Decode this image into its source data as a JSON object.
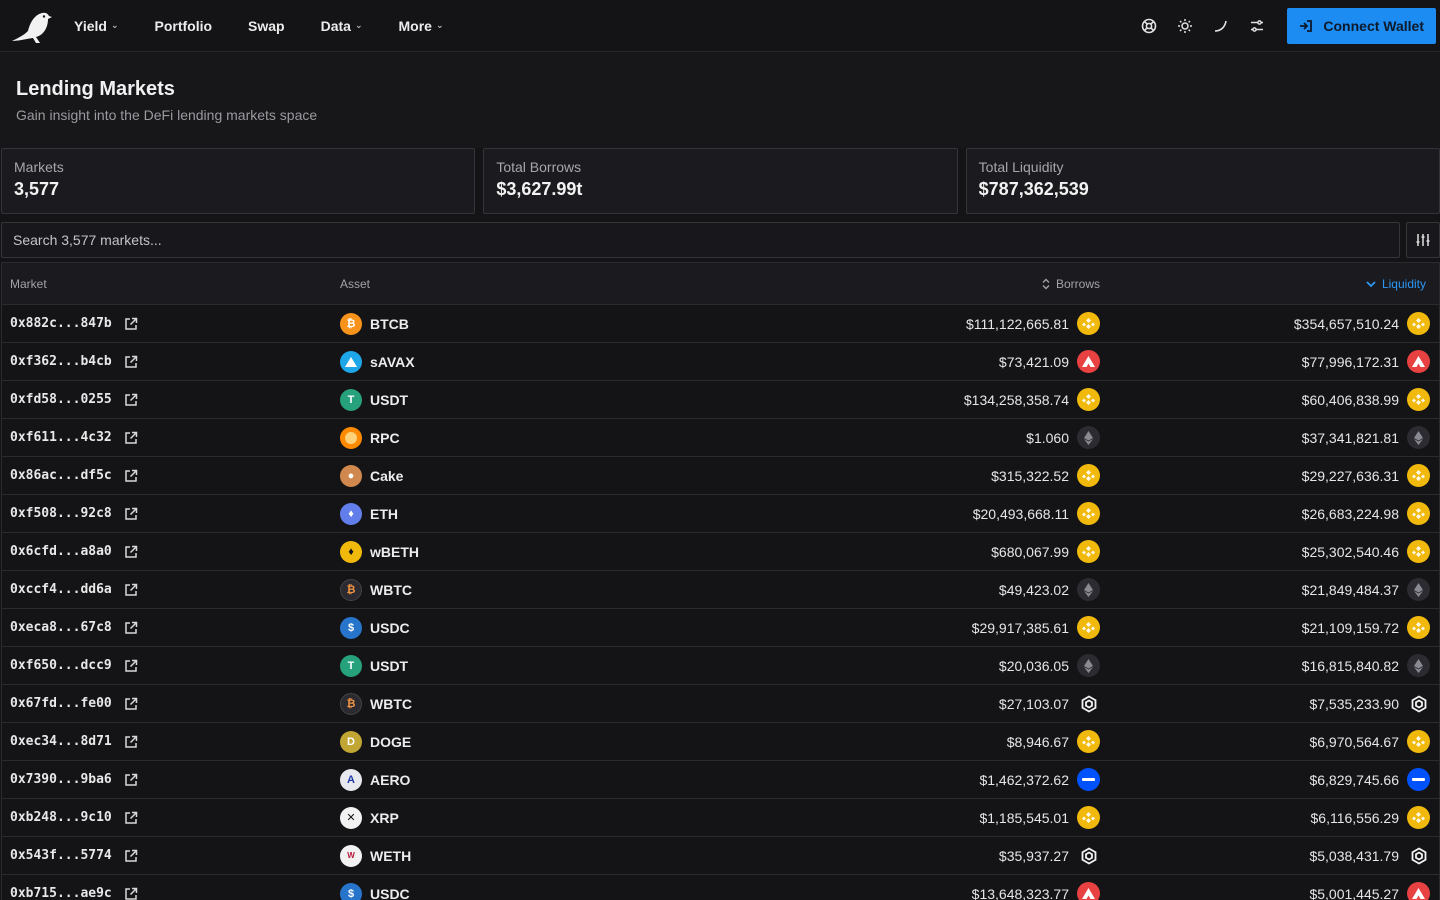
{
  "nav": {
    "items": [
      {
        "label": "Yield",
        "dropdown": true
      },
      {
        "label": "Portfolio",
        "dropdown": false
      },
      {
        "label": "Swap",
        "dropdown": false
      },
      {
        "label": "Data",
        "dropdown": true
      },
      {
        "label": "More",
        "dropdown": true
      }
    ],
    "connect_label": "Connect Wallet"
  },
  "page": {
    "title": "Lending Markets",
    "subtitle": "Gain insight into the DeFi lending markets space"
  },
  "stats": [
    {
      "label": "Markets",
      "value": "3,577"
    },
    {
      "label": "Total Borrows",
      "value": "$3,627.99t"
    },
    {
      "label": "Total Liquidity",
      "value": "$787,362,539"
    }
  ],
  "search": {
    "placeholder": "Search 3,577 markets..."
  },
  "table": {
    "headers": {
      "market": "Market",
      "asset": "Asset",
      "borrows": "Borrows",
      "liquidity": "Liquidity"
    },
    "sorted_by": "Liquidity",
    "rows": [
      {
        "market": "0x882c...847b",
        "asset": "BTCB",
        "asset_icon": "btcb",
        "borrows": "$111,122,665.81",
        "liquidity": "$354,657,510.24",
        "chain": "bnb"
      },
      {
        "market": "0xf362...b4cb",
        "asset": "sAVAX",
        "asset_icon": "savax",
        "borrows": "$73,421.09",
        "liquidity": "$77,996,172.31",
        "chain": "avalanche"
      },
      {
        "market": "0xfd58...0255",
        "asset": "USDT",
        "asset_icon": "usdt",
        "borrows": "$134,258,358.74",
        "liquidity": "$60,406,838.99",
        "chain": "bnb"
      },
      {
        "market": "0xf611...4c32",
        "asset": "RPC",
        "asset_icon": "rpc",
        "borrows": "$1.060",
        "liquidity": "$37,341,821.81",
        "chain": "ethereum"
      },
      {
        "market": "0x86ac...df5c",
        "asset": "Cake",
        "asset_icon": "cake",
        "borrows": "$315,322.52",
        "liquidity": "$29,227,636.31",
        "chain": "bnb"
      },
      {
        "market": "0xf508...92c8",
        "asset": "ETH",
        "asset_icon": "eth",
        "borrows": "$20,493,668.11",
        "liquidity": "$26,683,224.98",
        "chain": "bnb"
      },
      {
        "market": "0x6cfd...a8a0",
        "asset": "wBETH",
        "asset_icon": "wbeth",
        "borrows": "$680,067.99",
        "liquidity": "$25,302,540.46",
        "chain": "bnb"
      },
      {
        "market": "0xccf4...dd6a",
        "asset": "WBTC",
        "asset_icon": "wbtc",
        "borrows": "$49,423.02",
        "liquidity": "$21,849,484.37",
        "chain": "ethereum"
      },
      {
        "market": "0xeca8...67c8",
        "asset": "USDC",
        "asset_icon": "usdc",
        "borrows": "$29,917,385.61",
        "liquidity": "$21,109,159.72",
        "chain": "bnb"
      },
      {
        "market": "0xf650...dcc9",
        "asset": "USDT",
        "asset_icon": "usdt",
        "borrows": "$20,036.05",
        "liquidity": "$16,815,840.82",
        "chain": "ethereum"
      },
      {
        "market": "0x67fd...fe00",
        "asset": "WBTC",
        "asset_icon": "wbtc",
        "borrows": "$27,103.07",
        "liquidity": "$7,535,233.90",
        "chain": "hexagon"
      },
      {
        "market": "0xec34...8d71",
        "asset": "DOGE",
        "asset_icon": "doge",
        "borrows": "$8,946.67",
        "liquidity": "$6,970,564.67",
        "chain": "bnb"
      },
      {
        "market": "0x7390...9ba6",
        "asset": "AERO",
        "asset_icon": "aero",
        "borrows": "$1,462,372.62",
        "liquidity": "$6,829,745.66",
        "chain": "base"
      },
      {
        "market": "0xb248...9c10",
        "asset": "XRP",
        "asset_icon": "xrp",
        "borrows": "$1,185,545.01",
        "liquidity": "$6,116,556.29",
        "chain": "bnb"
      },
      {
        "market": "0x543f...5774",
        "asset": "WETH",
        "asset_icon": "weth",
        "borrows": "$35,937.27",
        "liquidity": "$5,038,431.79",
        "chain": "hexagon"
      },
      {
        "market": "0xb715...ae9c",
        "asset": "USDC",
        "asset_icon": "usdc",
        "borrows": "$13,648,323.77",
        "liquidity": "$5,001,445.27",
        "chain": "avalanche"
      }
    ]
  },
  "colors": {
    "accent": "#1d8cf2",
    "bnb": "#f0b90b",
    "avalanche": "#e84142",
    "base": "#0052ff"
  }
}
